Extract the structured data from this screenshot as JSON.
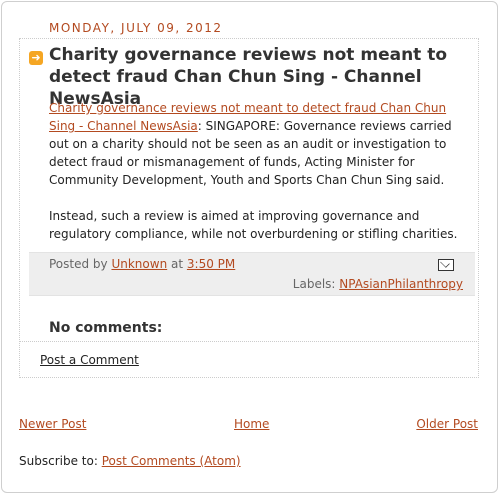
{
  "date_header": "MONDAY, JULY 09, 2012",
  "post": {
    "title": "Charity governance reviews not meant to detect fraud Chan Chun Sing - Channel NewsAsia",
    "body_link": "Charity governance reviews not meant to detect fraud Chan Chun Sing - Channel NewsAsia",
    "body_text1": ": SINGAPORE: Governance reviews carried out on a charity should not be seen as an audit or investigation to detect fraud or mismanagement of funds, Acting Minister for Community Development, Youth and Sports Chan Chun Sing said.",
    "body_text2": "Instead, such a review is aimed at improving governance and regulatory compliance, while not overburdening or stifling charities."
  },
  "footer": {
    "posted_by": "Posted by",
    "author": "Unknown",
    "at": "at",
    "time": "3:50 PM",
    "labels_prefix": "Labels:",
    "label": "NPAsianPhilanthropy"
  },
  "comments": {
    "heading": "No comments:",
    "post_comment": "Post a Comment"
  },
  "pager": {
    "newer": "Newer Post",
    "home": "Home",
    "older": "Older Post"
  },
  "subscribe": {
    "prefix": "Subscribe to:",
    "link": "Post Comments (Atom)"
  },
  "icons": {
    "title_icon": "arrow-right-icon",
    "email_icon": "email-post-icon"
  },
  "colors": {
    "accent": "#b34a20",
    "title_icon": "#f5a623",
    "footer_bg": "#eeeeee"
  }
}
